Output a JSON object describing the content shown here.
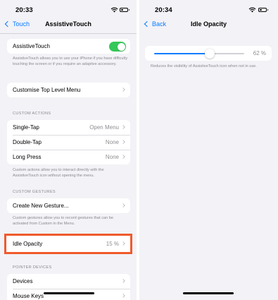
{
  "left": {
    "status": {
      "time": "20:33"
    },
    "nav": {
      "back_label": "Touch",
      "title": "AssistiveTouch"
    },
    "assistive_row": {
      "label": "AssistiveTouch",
      "toggle_on": true
    },
    "assistive_footnote": "AssistiveTouch allows you to use your iPhone if you have difficulty touching the screen or if you require an adaptive accessory.",
    "customise_row": {
      "label": "Customise Top Level Menu"
    },
    "custom_actions": {
      "header": "CUSTOM ACTIONS",
      "rows": [
        {
          "label": "Single-Tap",
          "value": "Open Menu"
        },
        {
          "label": "Double-Tap",
          "value": "None"
        },
        {
          "label": "Long Press",
          "value": "None"
        }
      ],
      "footnote": "Custom actions allow you to interact directly with the AssistiveTouch icon without opening the menu."
    },
    "custom_gestures": {
      "header": "CUSTOM GESTURES",
      "create_label": "Create New Gesture...",
      "footnote": "Custom gestures allow you to record gestures that can be activated from Custom in the Menu."
    },
    "idle_opacity": {
      "label": "Idle Opacity",
      "value": "15 %"
    },
    "pointer_devices": {
      "header": "POINTER DEVICES",
      "rows": [
        {
          "label": "Devices"
        },
        {
          "label": "Mouse Keys"
        }
      ]
    }
  },
  "right": {
    "status": {
      "time": "20:34"
    },
    "nav": {
      "back_label": "Back",
      "title": "Idle Opacity"
    },
    "slider": {
      "value": 0.62,
      "value_label": "62 %"
    },
    "footnote": "Reduces the visibility of AssistiveTouch icon when not in use."
  },
  "colors": {
    "accent": "#0a7cff",
    "toggle_on": "#34c759",
    "highlight": "#f05a2b"
  }
}
